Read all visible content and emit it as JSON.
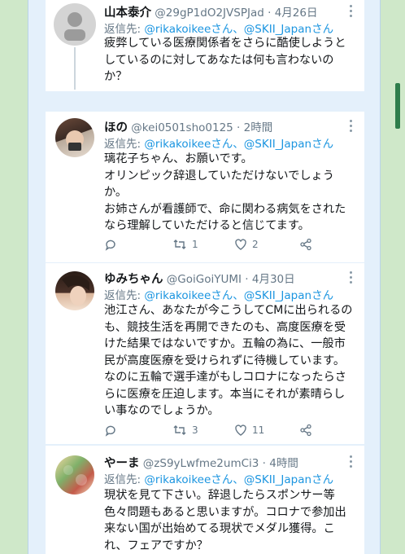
{
  "tweets": [
    {
      "name": "山本泰介",
      "handle": "@29gP1dO2JVSPJad",
      "time": "4月26日",
      "reply_prefix": "返信先: ",
      "reply_handles": "@rikakoikeeさん、@SKII_Japanさん",
      "text": "疲弊している医療関係者をさらに酷使しようとしているのに対してあなたは何も言わないのか？"
    },
    {
      "name": "ほの",
      "handle": "@kei0501sho0125",
      "time": "2時間",
      "reply_prefix": "返信先: ",
      "reply_handles": "@rikakoikeeさん、@SKII_Japanさん",
      "text": "璃花子ちゃん、お願いです。\nオリンピック辞退していただけないでしょうか。\nお姉さんが看護師で、命に関わる病気をされたなら理解していただけると信じてます。",
      "retweets": "1",
      "likes": "2"
    },
    {
      "name": "ゆみちゃん",
      "handle": "@GoiGoiYUMI",
      "time": "4月30日",
      "reply_prefix": "返信先: ",
      "reply_handles": "@rikakoikeeさん、@SKII_Japanさん",
      "text": "池江さん、あなたが今こうしてCMに出られるのも、競技生活を再開できたのも、高度医療を受けた結果ではないですか。五輪の為に、一般市民が高度医療を受けられずに待機しています。なのに五輪で選手達がもしコロナになったらさらに医療を圧迫します。本当にそれが素晴らしい事なのでしょうか。",
      "retweets": "3",
      "likes": "11"
    },
    {
      "name": "やーま",
      "handle": "@zS9yLwfme2umCi3",
      "time": "4時間",
      "reply_prefix": "返信先: ",
      "reply_handles": "@rikakoikeeさん、@SKII_Japanさん",
      "text": "現状を見て下さい。辞退したらスポンサー等色々問題もあると思いますが。コロナで参加出来ない国が出始めてる現状でメダル獲得。これ、フェアですか？"
    }
  ],
  "colors": {
    "link": "#1b95e0",
    "meta": "#657786",
    "text": "#14171a"
  }
}
